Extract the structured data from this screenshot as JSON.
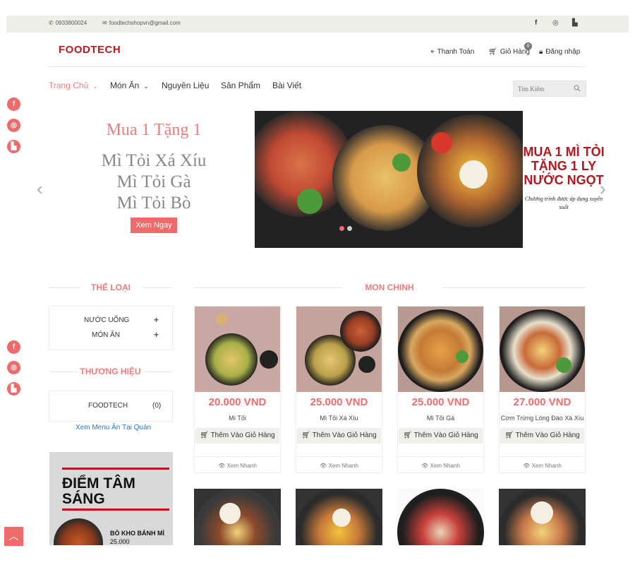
{
  "topbar": {
    "phone": "0933800024",
    "email": "foodtechshopvn@gmail.com",
    "social_icons": [
      "facebook-icon",
      "instagram-icon",
      "shop-bag-icon"
    ]
  },
  "header": {
    "logo": "FOODTECH",
    "checkout": "Thanh Toán",
    "cart": "Giỏ Hàng",
    "cart_count": "0",
    "login": "Đăng nhập"
  },
  "nav": {
    "items": [
      {
        "label": "Trang Chủ",
        "active": true,
        "dropdown": true
      },
      {
        "label": "Món Ăn",
        "active": false,
        "dropdown": true
      },
      {
        "label": "Nguyên Liệu",
        "active": false,
        "dropdown": false
      },
      {
        "label": "Sản Phẩm",
        "active": false,
        "dropdown": false
      },
      {
        "label": "Bài Viết",
        "active": false,
        "dropdown": false
      }
    ],
    "search_placeholder": "Tìm Kiếm"
  },
  "slider": {
    "promo_title": "Mua 1 Tặng 1",
    "promo_lines": [
      "Mì Tỏi Xá Xíu",
      "Mì Tỏi Gà",
      "Mì Tỏi Bò"
    ],
    "button": "Xem Ngay",
    "banner_text": [
      "MUA 1 MÌ TỎI",
      "TẶNG 1  LY",
      "NƯỚC NGỌT"
    ],
    "banner_sub": "Chương trình được áp dụng xuyên suốt",
    "active_slide": 1,
    "slide_count": 2
  },
  "sidebar": {
    "category_title": "THỂ LOẠI",
    "categories": [
      "NƯỚC UỐNG",
      "MÓN ĂN"
    ],
    "brand_title": "THƯƠNG HIỆU",
    "brand": {
      "name": "FOODTECH",
      "count": "(0)"
    },
    "menu_link": "Xem Menu Ăn Tại Quán",
    "ad": {
      "title_line1": "ĐIỂM TÂM",
      "title_line2": "SÁNG",
      "dish": "BÒ KHO BÁNH MÌ",
      "price": "25.000"
    }
  },
  "main": {
    "section_title": "MON CHINH",
    "products": [
      {
        "price": "20.000 VND",
        "name": "Mì Tỏi",
        "add": "Thêm Vào Giỏ Hàng",
        "quick": "Xem Nhanh"
      },
      {
        "price": "25.000 VND",
        "name": "Mì Tỏi Xá Xíu",
        "add": "Thêm Vào Giỏ Hàng",
        "quick": "Xem Nhanh"
      },
      {
        "price": "25.000 VND",
        "name": "Mì Tỏi Gà",
        "add": "Thêm Vào Giỏ Hàng",
        "quick": "Xem Nhanh"
      },
      {
        "price": "27.000 VND",
        "name": "Cơm Trứng Lòng Đào Xá Xíu",
        "add": "Thêm Vào Giỏ Hàng",
        "quick": "Xem Nhanh"
      }
    ]
  },
  "colors": {
    "accent": "#ef6b6b",
    "brand_red": "#c0161f",
    "topbar_bg": "#efefe9",
    "link_blue": "#2878c8"
  }
}
